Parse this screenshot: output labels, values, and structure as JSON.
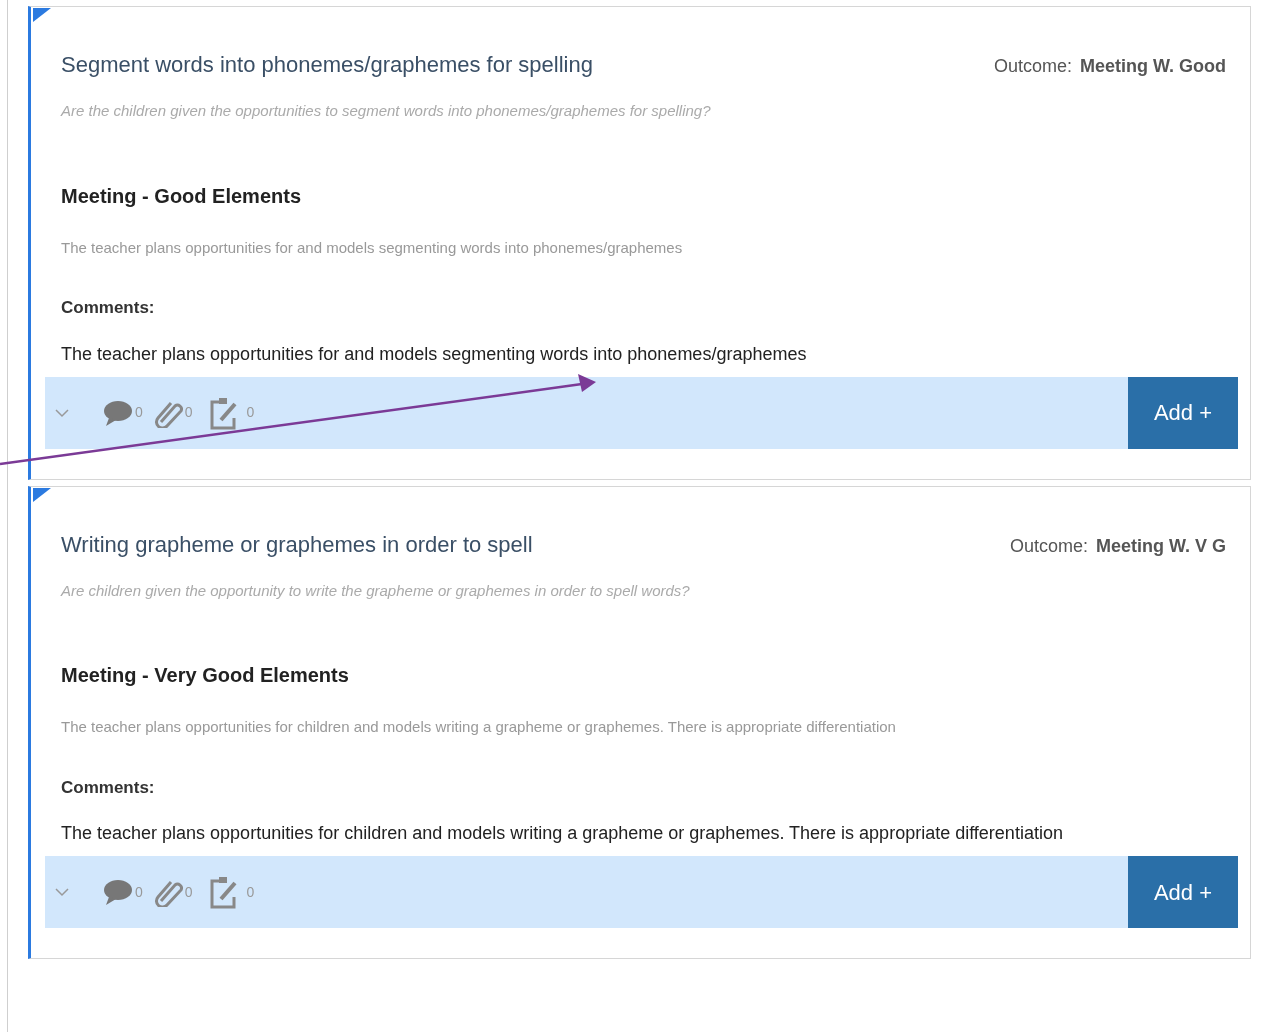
{
  "cards": [
    {
      "title": "Segment words into phonemes/graphemes for spelling",
      "outcome_label": "Outcome:",
      "outcome_value": "Meeting W. Good",
      "question": "Are the children given the opportunities to segment words into phonemes/graphemes for spelling?",
      "heading": "Meeting - Good Elements",
      "description": "The teacher plans opportunities for and models segmenting words into phonemes/graphemes",
      "comments_label": "Comments:",
      "comment": "The teacher plans opportunities for and models segmenting words into phonemes/graphemes",
      "counts": {
        "comments": "0",
        "attachments": "0",
        "notes": "0"
      },
      "add_button": "Add +"
    },
    {
      "title": "Writing grapheme or graphemes in order to spell",
      "outcome_label": "Outcome:",
      "outcome_value": "Meeting W. V G",
      "question": "Are children given the opportunity to write the grapheme or graphemes in order to spell words?",
      "heading": "Meeting - Very Good Elements",
      "description": "The teacher plans opportunities for children and models writing a grapheme or graphemes. There is appropriate differentiation",
      "comments_label": "Comments:",
      "comment": "The teacher plans opportunities for children and models writing a grapheme or graphemes. There is appropriate differentiation",
      "counts": {
        "comments": "0",
        "attachments": "0",
        "notes": "0"
      },
      "add_button": "Add +"
    }
  ]
}
